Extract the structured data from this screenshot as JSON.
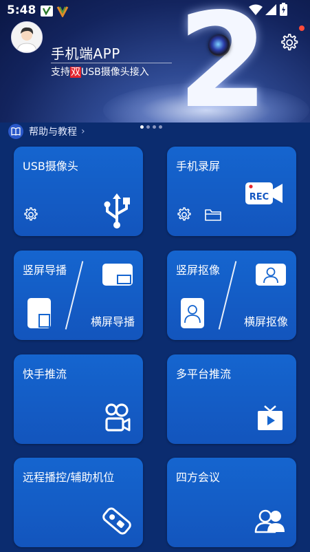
{
  "status_bar": {
    "time": "5:48"
  },
  "banner": {
    "title": "手机端APP",
    "subtitle_pre": "支持",
    "subtitle_highlight": "双",
    "subtitle_post": "USB摄像头接入",
    "big_number": "2",
    "carousel_total": 4,
    "carousel_active": 1
  },
  "help": {
    "label": "帮助与教程",
    "chevron": "›"
  },
  "cards": {
    "usb_camera": {
      "title": "USB摄像头"
    },
    "screen_record": {
      "title": "手机录屏",
      "rec_label": "REC"
    },
    "vertical_director": {
      "title": "竖屏导播",
      "alt_title": "横屏导播"
    },
    "vertical_matting": {
      "title": "竖屏抠像",
      "alt_title": "横屏抠像"
    },
    "kuaishou_stream": {
      "title": "快手推流"
    },
    "multi_platform_stream": {
      "title": "多平台推流"
    },
    "remote_control": {
      "title": "远程播控/辅助机位"
    },
    "meeting": {
      "title": "四方会议"
    }
  },
  "colors": {
    "background": "#0b2c6f",
    "card": "#1565cf",
    "badge_red": "#ff4b3a",
    "highlight": "#e5262e"
  }
}
